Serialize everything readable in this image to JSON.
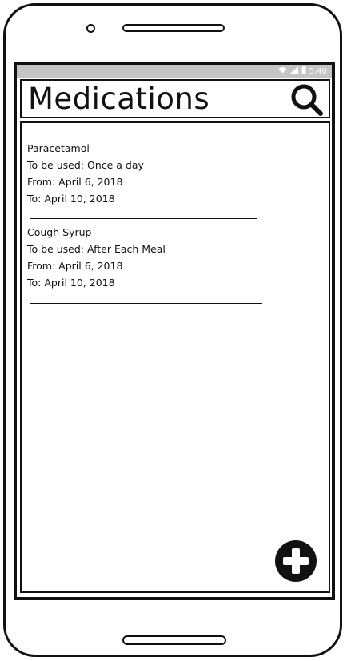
{
  "status_bar": {
    "time": "5:40",
    "icons": [
      "wifi-icon",
      "signal-icon",
      "battery-icon"
    ]
  },
  "app_bar": {
    "title": "Medications",
    "search_icon": "search-icon"
  },
  "medications": [
    {
      "name": "Paracetamol",
      "usage": "To be used: Once a day",
      "from": "From: April 6, 2018",
      "to": "To: April 10, 2018"
    },
    {
      "name": "Cough Syrup",
      "usage": "To be used: After Each Meal",
      "from": "From: April 6, 2018",
      "to": "To: April 10, 2018"
    }
  ],
  "fab": {
    "icon": "plus-icon"
  }
}
